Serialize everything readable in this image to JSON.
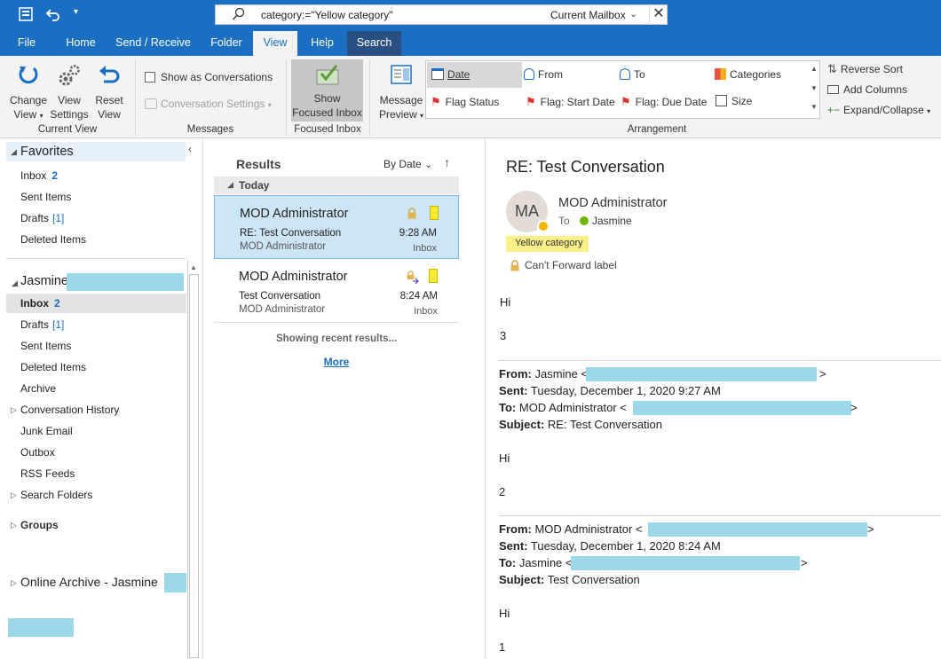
{
  "search": {
    "query": "category:=\"Yellow category\"",
    "scope": "Current Mailbox"
  },
  "tabs": [
    {
      "label": "File"
    },
    {
      "label": "Home"
    },
    {
      "label": "Send / Receive"
    },
    {
      "label": "Folder"
    },
    {
      "label": "View"
    },
    {
      "label": "Help"
    },
    {
      "label": "Search"
    }
  ],
  "ribbon": {
    "current_view": {
      "change_view": [
        "Change",
        "View"
      ],
      "view_settings": [
        "View",
        "Settings"
      ],
      "reset_view": [
        "Reset",
        "View"
      ],
      "label": "Current View"
    },
    "messages": {
      "show_as_conversations": "Show as Conversations",
      "conversation_settings": "Conversation Settings",
      "label": "Messages"
    },
    "focused_inbox": {
      "button": [
        "Show",
        "Focused Inbox"
      ],
      "label": "Focused Inbox"
    },
    "arrangement": {
      "message_preview": [
        "Message",
        "Preview"
      ],
      "items": [
        "Date",
        "From",
        "To",
        "Categories",
        "Flag Status",
        "Flag: Start Date",
        "Flag: Due Date",
        "Size"
      ],
      "reverse_sort": "Reverse Sort",
      "add_columns": "Add Columns",
      "expand_collapse": "Expand/Collapse",
      "label": "Arrangement"
    }
  },
  "folders": {
    "favorites_header": "Favorites",
    "favorites": [
      {
        "label": "Inbox",
        "count": "2"
      },
      {
        "label": "Sent Items"
      },
      {
        "label": "Drafts",
        "count": "[1]"
      },
      {
        "label": "Deleted Items"
      }
    ],
    "account_name": "Jasmine",
    "account": [
      {
        "label": "Inbox",
        "count": "2"
      },
      {
        "label": "Drafts",
        "count": "[1]"
      },
      {
        "label": "Sent Items"
      },
      {
        "label": "Deleted Items"
      },
      {
        "label": "Archive"
      },
      {
        "label": "Conversation History"
      },
      {
        "label": "Junk Email"
      },
      {
        "label": "Outbox"
      },
      {
        "label": "RSS Feeds"
      },
      {
        "label": "Search Folders"
      }
    ],
    "groups": "Groups",
    "online_archive": "Online Archive - Jasmine"
  },
  "results": {
    "title": "Results",
    "sort": "By Date",
    "group": "Today",
    "messages": [
      {
        "from": "MOD Administrator",
        "subject": "RE: Test Conversation",
        "preview": "MOD Administrator",
        "time": "9:28 AM",
        "folder": "Inbox"
      },
      {
        "from": "MOD Administrator",
        "subject": "Test Conversation",
        "preview": "MOD Administrator",
        "time": "8:24 AM",
        "folder": "Inbox"
      }
    ],
    "status": "Showing recent results...",
    "more": "More"
  },
  "reading": {
    "subject": "RE: Test Conversation",
    "avatar": "MA",
    "sender": "MOD Administrator",
    "to_label": "To",
    "to": "Jasmine",
    "category": "Yellow category",
    "label": "Can't Forward label",
    "body": [
      {
        "type": "text",
        "value": "Hi"
      },
      {
        "type": "text",
        "value": "3"
      }
    ],
    "quoted": [
      {
        "from_label": "From:",
        "from": "Jasmine <",
        "sent_label": "Sent:",
        "sent": "Tuesday, December 1, 2020 9:27 AM",
        "to_label": "To:",
        "to": "MOD Administrator <",
        "subject_label": "Subject:",
        "subject": "RE: Test Conversation",
        "hi": "Hi",
        "num": "2"
      },
      {
        "from_label": "From:",
        "from": "MOD Administrator <",
        "sent_label": "Sent:",
        "sent": "Tuesday, December 1, 2020 8:24 AM",
        "to_label": "To:",
        "to": "Jasmine <",
        "subject_label": "Subject:",
        "subject": "Test Conversation",
        "hi": "Hi",
        "num": "1"
      }
    ],
    "close_bracket": ">"
  },
  "colors": {
    "accent": "#1a6fc2",
    "redaction": "#9dd8ea",
    "yellow_category": "#f7ea2f",
    "selected_row": "#cde6f7"
  }
}
